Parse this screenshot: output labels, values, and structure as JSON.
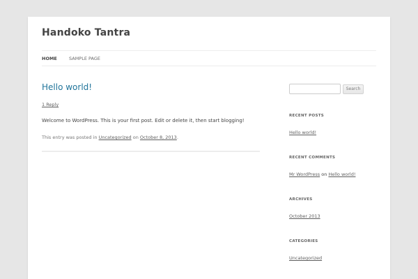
{
  "site": {
    "title": "Handoko Tantra"
  },
  "nav": {
    "items": [
      {
        "label": "Home"
      },
      {
        "label": "Sample Page"
      }
    ]
  },
  "post": {
    "title": "Hello world!",
    "reply_link": "1 Reply",
    "content": "Welcome to WordPress. This is your first post. Edit or delete it, then start blogging!",
    "meta_prefix": "This entry was posted in ",
    "category": "Uncategorized",
    "meta_on": " on ",
    "date": "October 8, 2013",
    "meta_suffix": "."
  },
  "sidebar": {
    "search": {
      "value": "",
      "button_label": "Search"
    },
    "recent_posts": {
      "title": "Recent Posts",
      "items": [
        "Hello world!"
      ]
    },
    "recent_comments": {
      "title": "Recent Comments",
      "author": "Mr WordPress",
      "on": " on ",
      "post": "Hello world!"
    },
    "archives": {
      "title": "Archives",
      "items": [
        "October 2013"
      ]
    },
    "categories": {
      "title": "Categories",
      "items": [
        "Uncategorized"
      ]
    }
  },
  "colors": {
    "background": "#e6e6e6",
    "page": "#ffffff",
    "link_accent": "#21759b",
    "text": "#444444"
  }
}
